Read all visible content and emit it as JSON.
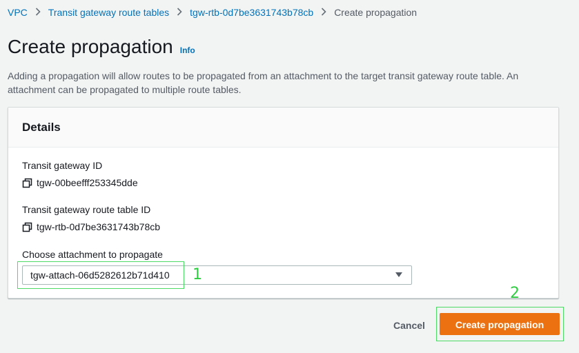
{
  "breadcrumb": {
    "items": [
      "VPC",
      "Transit gateway route tables",
      "tgw-rtb-0d7be3631743b78cb"
    ],
    "current": "Create propagation"
  },
  "page": {
    "title": "Create propagation",
    "info_label": "Info",
    "description": "Adding a propagation will allow routes to be propagated from an attachment to the target transit gateway route table. An attachment can be propagated to multiple route tables."
  },
  "details": {
    "title": "Details",
    "transit_gateway_id_label": "Transit gateway ID",
    "transit_gateway_id_value": "tgw-00beefff253345dde",
    "route_table_id_label": "Transit gateway route table ID",
    "route_table_id_value": "tgw-rtb-0d7be3631743b78cb",
    "attachment_label": "Choose attachment to propagate",
    "attachment_selected": "tgw-attach-06d5282612b71d410"
  },
  "annotations": {
    "marker_1": "1",
    "marker_2": "2",
    "color": "#2ecc40"
  },
  "footer": {
    "cancel_label": "Cancel",
    "create_label": "Create propagation"
  },
  "colors": {
    "link": "#0073bb",
    "primary_button": "#ec7211",
    "background": "#f2f3f3"
  },
  "icons": {
    "breadcrumb_separator": "chevron-right-icon",
    "copy": "copy-icon",
    "select": "caret-down-icon"
  }
}
